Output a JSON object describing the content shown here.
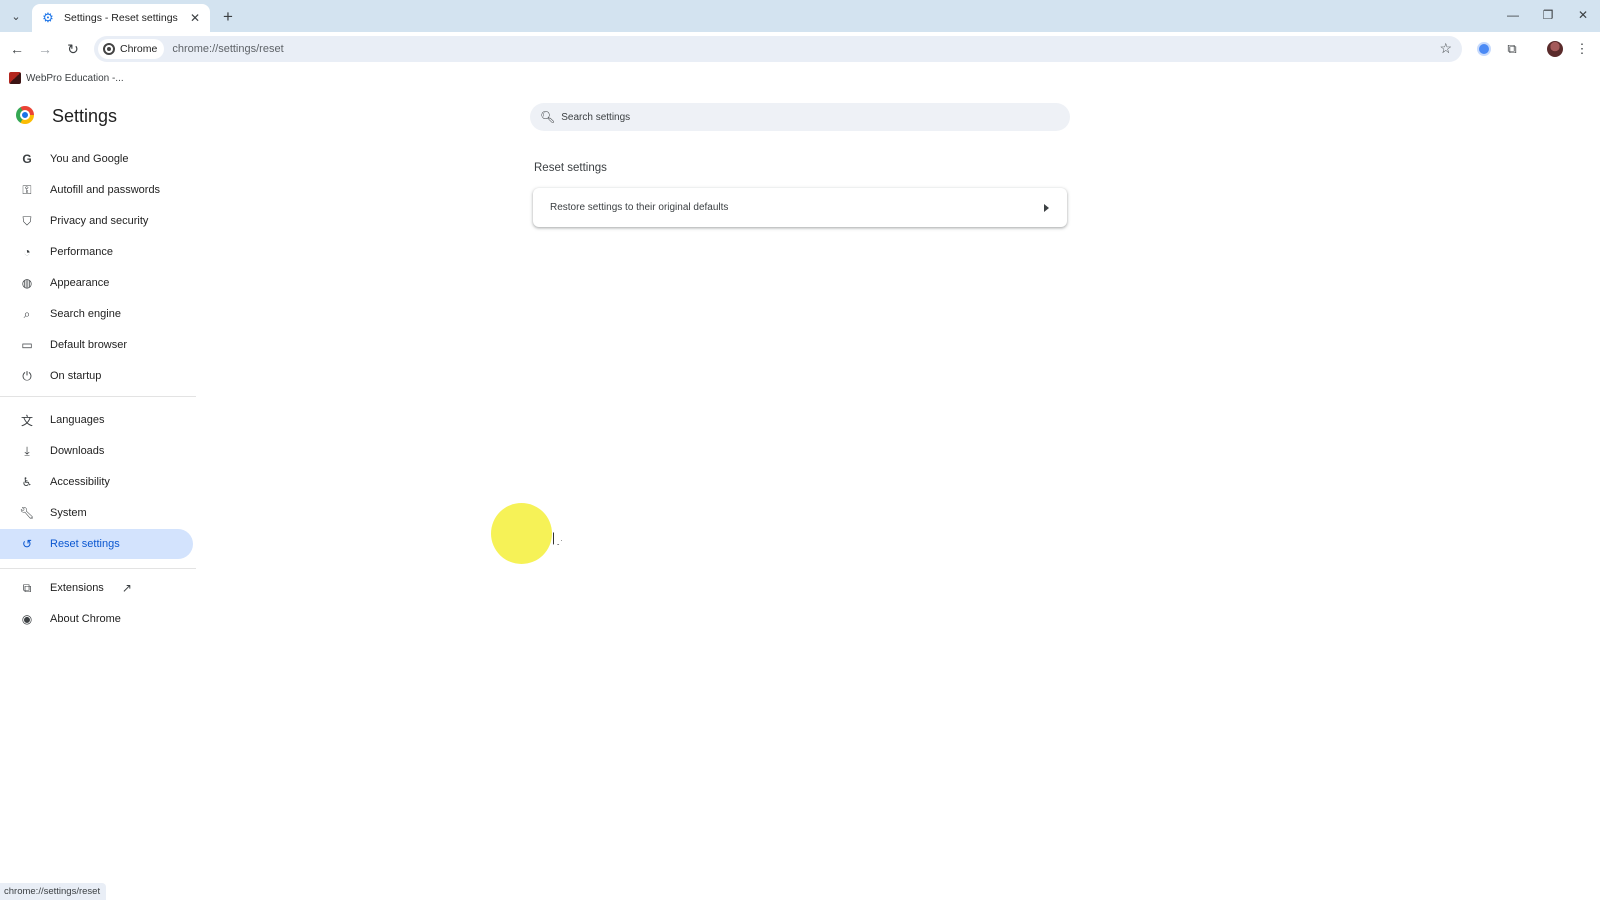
{
  "tab": {
    "title": "Settings - Reset settings",
    "favicon": "gear-icon"
  },
  "toolbar": {
    "chip_label": "Chrome",
    "url": "chrome://settings/reset"
  },
  "bookmarks": [
    {
      "label": "WebPro Education -..."
    }
  ],
  "header": {
    "title": "Settings"
  },
  "search": {
    "placeholder": "Search settings"
  },
  "sidebar": {
    "items": [
      {
        "label": "You and Google",
        "icon": "google-g-icon"
      },
      {
        "label": "Autofill and passwords",
        "icon": "key-icon"
      },
      {
        "label": "Privacy and security",
        "icon": "shield-icon"
      },
      {
        "label": "Performance",
        "icon": "speedometer-icon"
      },
      {
        "label": "Appearance",
        "icon": "palette-icon"
      },
      {
        "label": "Search engine",
        "icon": "search-icon"
      },
      {
        "label": "Default browser",
        "icon": "browser-window-icon"
      },
      {
        "label": "On startup",
        "icon": "power-icon"
      },
      {
        "label": "Languages",
        "icon": "translate-icon"
      },
      {
        "label": "Downloads",
        "icon": "download-icon"
      },
      {
        "label": "Accessibility",
        "icon": "accessibility-icon"
      },
      {
        "label": "System",
        "icon": "wrench-icon"
      },
      {
        "label": "Reset settings",
        "icon": "reset-icon",
        "active": true
      },
      {
        "label": "Extensions",
        "icon": "puzzle-icon"
      },
      {
        "label": "About Chrome",
        "icon": "chrome-icon"
      }
    ]
  },
  "main": {
    "section_title": "Reset settings",
    "row_label": "Restore settings to their original defaults"
  },
  "status": {
    "text": "chrome://settings/reset"
  },
  "colors": {
    "accent": "#0b57d0",
    "active_bg": "#d3e3fd",
    "tabstrip": "#d3e3f0",
    "highlight": "#f5f03a"
  }
}
